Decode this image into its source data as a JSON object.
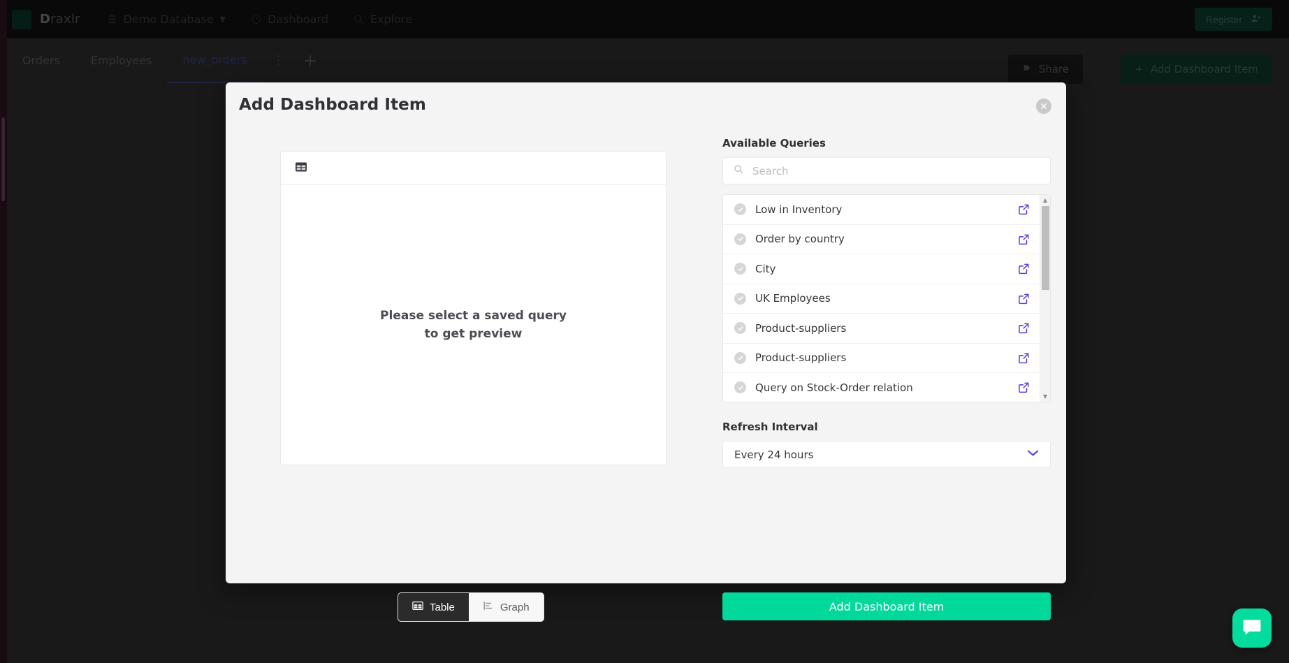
{
  "app": {
    "brand_bold": "D",
    "brand_rest": "raxlr",
    "nav": {
      "database": "Demo Database",
      "dashboard": "Dashboard",
      "explore": "Explore"
    },
    "register_label": "Register"
  },
  "tabs": {
    "items": [
      {
        "label": "Orders",
        "active": false
      },
      {
        "label": "Employees",
        "active": false
      },
      {
        "label": "new_orders",
        "active": true
      }
    ],
    "share_label": "Share",
    "add_item_label": "Add Dashboard Item"
  },
  "modal": {
    "title": "Add Dashboard Item",
    "close_label": "✕",
    "preview": {
      "empty_line1": "Please select a saved query",
      "empty_line2": "to get preview"
    },
    "view_toggle": {
      "table_label": "Table",
      "graph_label": "Graph",
      "active": "Table"
    },
    "queries": {
      "section_label": "Available Queries",
      "search_placeholder": "Search",
      "search_value": "",
      "items": [
        {
          "label": "Low in Inventory"
        },
        {
          "label": "Order by country"
        },
        {
          "label": "City"
        },
        {
          "label": "UK Employees"
        },
        {
          "label": "Product-suppliers"
        },
        {
          "label": "Product-suppliers"
        },
        {
          "label": "Query on Stock-Order relation"
        }
      ]
    },
    "refresh": {
      "section_label": "Refresh Interval",
      "selected": "Every 24 hours"
    },
    "submit_label": "Add Dashboard Item"
  },
  "colors": {
    "accent_green": "#00d99a",
    "chat_green": "#04dc9e",
    "purple_link": "#5b3ce0",
    "modal_bg": "#f4f4f4",
    "topbar_bg": "#111111"
  }
}
